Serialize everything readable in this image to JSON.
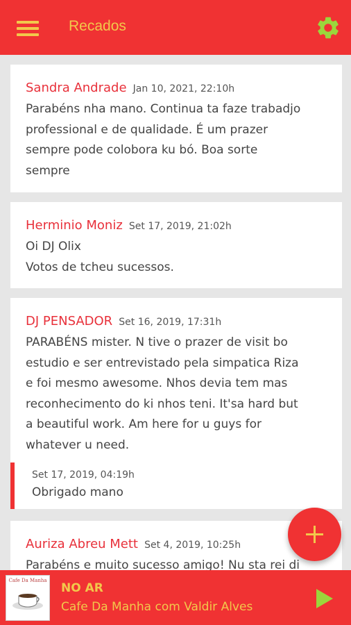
{
  "appbar": {
    "title": "Recados",
    "menu_icon": "menu-icon",
    "settings_icon": "gear-icon",
    "accent": "#f03233",
    "text_color": "#f2c84b"
  },
  "messages": [
    {
      "author": "Sandra Andrade",
      "date": "Jan 10, 2021, 22:10h",
      "text": "Parabéns nha mano. Continua ta  faze trabadjo\nprofessional e de qualidade. É um prazer\nsempre pode colobora ku bó. Boa sorte\nsempre"
    },
    {
      "author": "Herminio Moniz",
      "date": "Set 17, 2019, 21:02h",
      "text": "Oi DJ Olix\nVotos de tcheu sucessos."
    },
    {
      "author": "DJ PENSADOR",
      "date": "Set 16, 2019, 17:31h",
      "text": "PARABÉNS mister. N tive o prazer de visit bo\nestudio e ser entrevistado pela simpatica Riza\ne foi mesmo awesome. Nhos devia tem mas\nreconhecimento do ki nhos teni. It'sa  hard but\na beautiful work. Am here for u guys for\nwhatever u need.",
      "reply": {
        "date": "Set 17, 2019, 04:19h",
        "text": "Obrigado mano"
      }
    },
    {
      "author": "Auriza Abreu Mett",
      "date": "Set 4, 2019, 10:25h",
      "text": "Parabéns e muito sucesso amigo! Nu sta rei di"
    }
  ],
  "fab": {
    "icon": "plus-icon"
  },
  "player": {
    "status": "NO AR",
    "show": "Cafe Da Manha com Valdir Alves",
    "cover_text": "Cafe Da Manha",
    "play_icon": "play-icon"
  }
}
